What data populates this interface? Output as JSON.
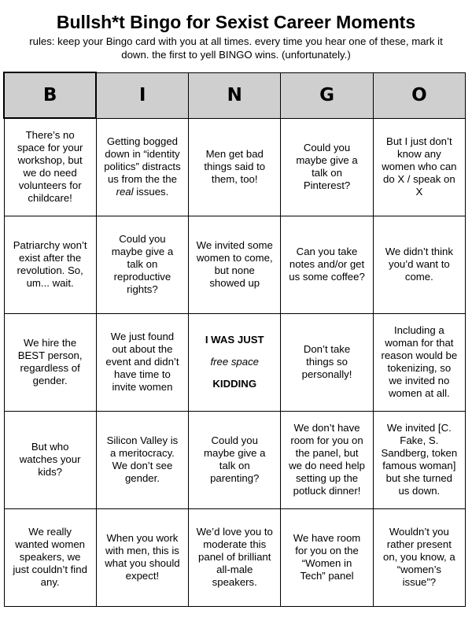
{
  "title": "Bullsh*t Bingo for Sexist Career Moments",
  "rules": "rules: keep your Bingo card with you at all times. every time you hear one of these, mark it\ndown. the first to yell BINGO wins. (unfortunately.)",
  "header": [
    "B",
    "I",
    "N",
    "G",
    "O"
  ],
  "rows": [
    {
      "cells": [
        {
          "text": "There’s no space for your workshop, but we do need volunteers for childcare!"
        },
        {
          "pre": "Getting bogged down in “identity politics” distracts us from the the",
          "em": "real",
          "post": " issues."
        },
        {
          "text": "Men get bad things said to them, too!"
        },
        {
          "text": "Could you maybe give a talk on Pinterest?"
        },
        {
          "text": "But I just don’t know any women who can do X / speak on X"
        }
      ]
    },
    {
      "cells": [
        {
          "text": "Patriarchy won’t exist after the revolution. So, um... wait."
        },
        {
          "text": "Could you maybe give a talk on reproductive rights?"
        },
        {
          "text": "We invited some women to come, but none showed up"
        },
        {
          "text": "Can you take notes and/or get us some coffee?"
        },
        {
          "text": "We didn’t think you’d want to come."
        }
      ]
    },
    {
      "cells": [
        {
          "text": "We hire the BEST person, regardless of gender."
        },
        {
          "text": "We just found out about the event and didn’t have time to invite women"
        },
        {
          "free_top": "I WAS JUST",
          "free_mid": "free space",
          "free_bottom": "KIDDING"
        },
        {
          "text": "Don’t take things so personally!"
        },
        {
          "text": "Including a woman for that reason would be tokenizing, so we invited no women at all."
        }
      ]
    },
    {
      "cells": [
        {
          "text": "But who watches your kids?"
        },
        {
          "text": "Silicon Valley is a meritocracy. We don’t see gender."
        },
        {
          "text": "Could you maybe give a talk on parenting?"
        },
        {
          "text": "We don’t have room for you on the panel, but we do need help setting up the potluck dinner!"
        },
        {
          "text": "We invited [C. Fake, S. Sandberg, token famous woman] but she turned us down."
        }
      ]
    },
    {
      "cells": [
        {
          "text": "We really wanted women speakers, we just couldn’t find any."
        },
        {
          "text": "When you work with men, this is what you should expect!"
        },
        {
          "text": "We’d love you to moderate this panel of brilliant all-male speakers."
        },
        {
          "text": "We have room for you on the “Women in Tech” panel"
        },
        {
          "text": "Wouldn’t you rather present on, you know, a “women’s issue”?"
        }
      ]
    }
  ]
}
